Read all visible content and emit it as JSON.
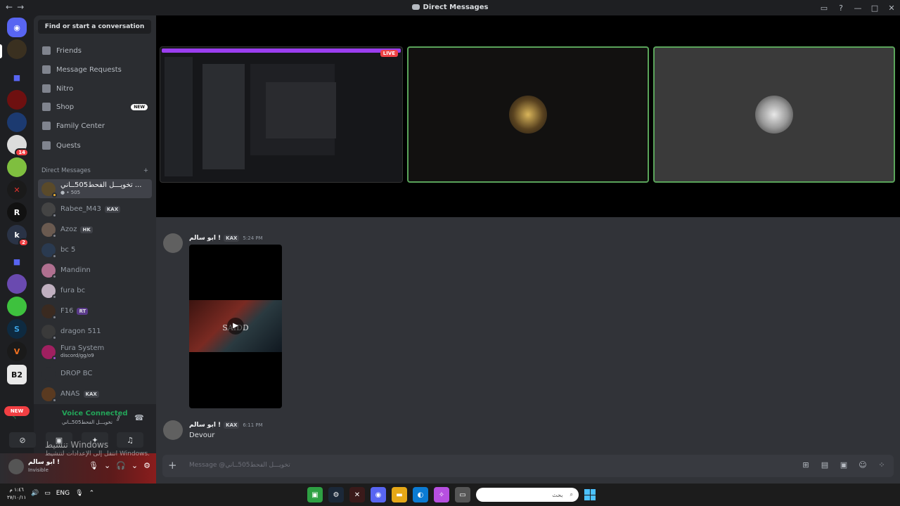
{
  "window": {
    "title": "Direct Messages",
    "nav_back": "←",
    "nav_forward": "→"
  },
  "sidebar": {
    "search_placeholder": "Find or start a conversation",
    "nav": [
      {
        "label": "Friends"
      },
      {
        "label": "Message Requests"
      },
      {
        "label": "Nitro"
      },
      {
        "label": "Shop",
        "badge": "NEW"
      },
      {
        "label": "Family Center"
      },
      {
        "label": "Quests"
      }
    ],
    "dm_header": "Direct Messages",
    "dm_add": "+",
    "dms": [
      {
        "name": "تخويـــل الفحط505ــاني ...",
        "sub": "505",
        "active": true
      },
      {
        "name": "Rabee_M43",
        "tag": "KAX"
      },
      {
        "name": "Azoz",
        "tag": "HK"
      },
      {
        "name": "bc 5"
      },
      {
        "name": "Mandinn"
      },
      {
        "name": "fura bc"
      },
      {
        "name": "F16",
        "tag": "RT"
      },
      {
        "name": "dragon 511"
      },
      {
        "name": "Fura System",
        "sub": "discord/gg/o9"
      },
      {
        "name": "DROP BC"
      },
      {
        "name": "ANAS",
        "tag": "KAX"
      }
    ]
  },
  "servers": {
    "badges": [
      "14",
      "2"
    ],
    "new_label": "NEW"
  },
  "voice": {
    "status": "Voice Connected",
    "channel": "تخويـــل الفحط505ــاني"
  },
  "user": {
    "name": "ابو سالم !",
    "status": "Invisible"
  },
  "stage": {
    "live_label": "LIVE"
  },
  "messages": [
    {
      "author": "ابو سالم !",
      "tag": "KAX",
      "time": "5:24 PM",
      "video_title": "SAIDD"
    },
    {
      "author": "ابو سالم !",
      "tag": "KAX",
      "time": "6:11 PM",
      "text": "Devour"
    }
  ],
  "composer": {
    "placeholder": "Message @تخويـــل الفحط505ــاني"
  },
  "activation": {
    "line1": "تنشيط Windows",
    "line2": "انتقل إلى الإعدادات لتنشيط Windows."
  },
  "taskbar": {
    "time": "١:٤٦ م",
    "date": "٢٧/١٠/١١",
    "lang": "ENG",
    "search_placeholder": "بحث"
  },
  "colors": {
    "accent": "#5865f2",
    "voice_green": "#23a559",
    "live_red": "#ed4245"
  }
}
